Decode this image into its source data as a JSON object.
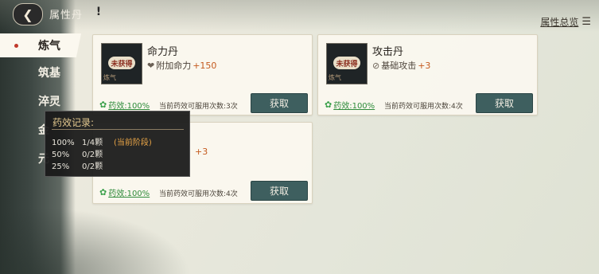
{
  "header": {
    "title": "属性丹",
    "help_glyph": "!",
    "overview_label": "属性总览"
  },
  "sidebar": {
    "items": [
      {
        "label": "炼气",
        "active": true
      },
      {
        "label": "筑基"
      },
      {
        "label": "淬灵"
      },
      {
        "label": "金"
      },
      {
        "label": "元"
      }
    ]
  },
  "cards": [
    {
      "name": "命力丹",
      "seal": "未获得",
      "tag": "炼气",
      "effect_label": "附加命力",
      "effect_bonus": "+150",
      "potency_label": "药效:100%",
      "uses_text": "当前药效可服用次数:3次",
      "button_label": "获取"
    },
    {
      "name": "攻击丹",
      "seal": "未获得",
      "tag": "炼气",
      "effect_label": "基础攻击",
      "effect_bonus": "+3",
      "potency_label": "药效:100%",
      "uses_text": "当前药效可服用次数:4次",
      "button_label": "获取"
    },
    {
      "name": "",
      "effect_bonus": "+3",
      "potency_label": "药效:100%",
      "uses_text": "当前药效可服用次数:4次",
      "button_label": "获取"
    }
  ],
  "tooltip": {
    "title": "药效记录:",
    "rows": [
      {
        "pct": "100%",
        "count": "1/4颗",
        "note": "(当前阶段)"
      },
      {
        "pct": "50%",
        "count": "0/2颗",
        "note": ""
      },
      {
        "pct": "25%",
        "count": "0/2颗",
        "note": ""
      }
    ]
  },
  "icons": {
    "back": "back-arrow-icon",
    "help": "exclamation-icon",
    "overview": "list-icon",
    "effect_heart": "heart-icon",
    "effect_attack": "slash-icon",
    "potency": "flame-icon"
  }
}
